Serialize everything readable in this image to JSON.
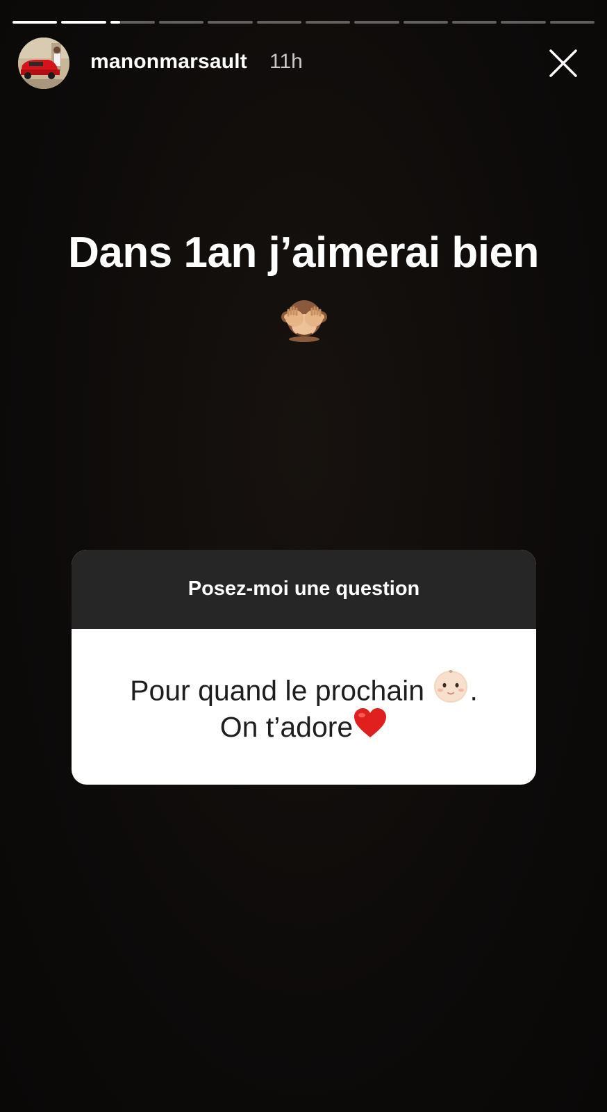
{
  "story": {
    "progress": [
      1,
      1,
      0.22,
      0,
      0,
      0,
      0,
      0,
      0,
      0,
      0,
      0
    ],
    "user": {
      "username": "manonmarsault",
      "time": "11h"
    },
    "caption": "Dans 1an j’aimerai bien",
    "caption_emoji": "see-no-evil-monkey-icon",
    "close_icon": "close-icon"
  },
  "question_sticker": {
    "title": "Posez-moi une question",
    "answer_line1": "Pour quand le prochain",
    "answer_line1_end": ".",
    "answer_line2": "On t’adore"
  },
  "colors": {
    "background": "#0c0a09",
    "sticker_header": "#262626",
    "sticker_body": "#ffffff",
    "heart": "#e0201f"
  }
}
